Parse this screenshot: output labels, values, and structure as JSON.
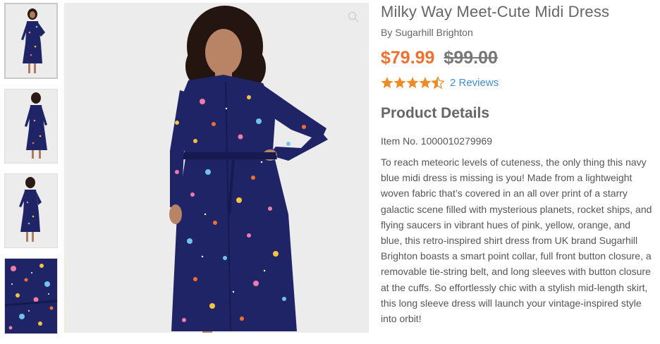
{
  "product": {
    "title": "Milky Way Meet-Cute Midi Dress",
    "brand_prefix": "By",
    "brand": "Sugarhill Brighton",
    "price_sale": "$79.99",
    "price_original": "$99.00",
    "rating": 4.5,
    "rating_max": 5,
    "reviews_link": "2 Reviews",
    "details_heading": "Product Details",
    "item_number": "Item No. 1000010279969",
    "description": "To reach meteoric levels of cuteness, the only thing this navy blue midi dress is missing is you! Made from a lightweight woven fabric that’s covered in an all over print of a starry galactic scene filled with mysterious planets, rocket ships, and flying saucers in vibrant hues of pink, yellow, orange, and blue, this retro-inspired shirt dress from UK brand Sugarhill Brighton boasts a smart point collar, full front button closure, a removable tie-string belt, and long sleeves with button closure at the cuffs. So effortlessly chic with a stylish mid-length skirt, this long sleeve dress will launch your vintage-inspired style into orbit!"
  },
  "gallery": {
    "thumbnails": [
      "front-view",
      "back-view",
      "side-view",
      "fabric-closeup"
    ],
    "selected": 0
  },
  "colors": {
    "accent_price": "#f07030",
    "star": "#f08a24",
    "link": "#3d8fd6",
    "dress_navy": "#1f2466"
  },
  "icons": [
    "zoom-icon",
    "star-icon",
    "star-half-icon"
  ]
}
